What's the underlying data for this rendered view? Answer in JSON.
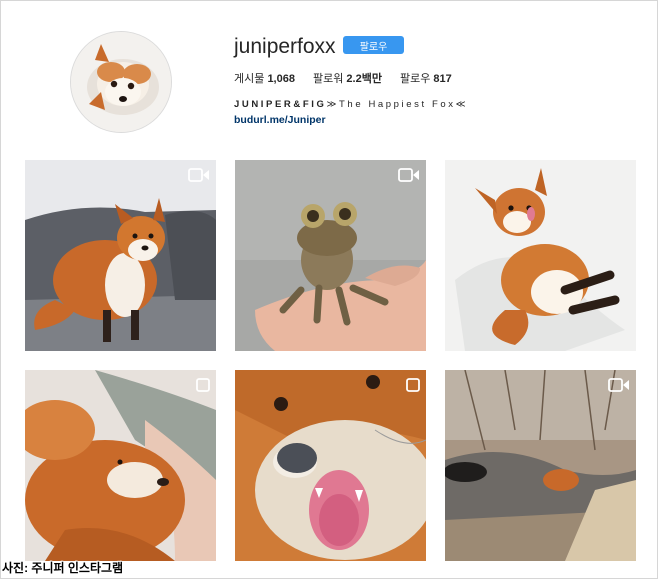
{
  "profile": {
    "username": "juniperfoxx",
    "follow_label": "팔로우",
    "stats": [
      {
        "label": "게시물",
        "value": "1,068"
      },
      {
        "label": "팔로워",
        "value": "2.2백만"
      },
      {
        "label": "팔로우",
        "value": "817"
      }
    ],
    "bio_name": "JUNIPER&FIG",
    "bio_text": "≫The Happiest Fox≪",
    "link": "budurl.me/Juniper"
  },
  "posts": [
    {
      "subject": "fox-on-sofa",
      "badge": "video-icon"
    },
    {
      "subject": "lizard-on-hand",
      "badge": "video-icon"
    },
    {
      "subject": "fox-on-bed",
      "badge": ""
    },
    {
      "subject": "fox-with-person",
      "badge": "multi-icon"
    },
    {
      "subject": "fox-closeup",
      "badge": "multi-icon"
    },
    {
      "subject": "fox-by-stream",
      "badge": "video-icon"
    }
  ],
  "caption": "사진: 주니퍼 인스타그램",
  "colors": {
    "follow_button": "#3897f0",
    "link": "#003569",
    "fox_orange": "#c8692a"
  }
}
